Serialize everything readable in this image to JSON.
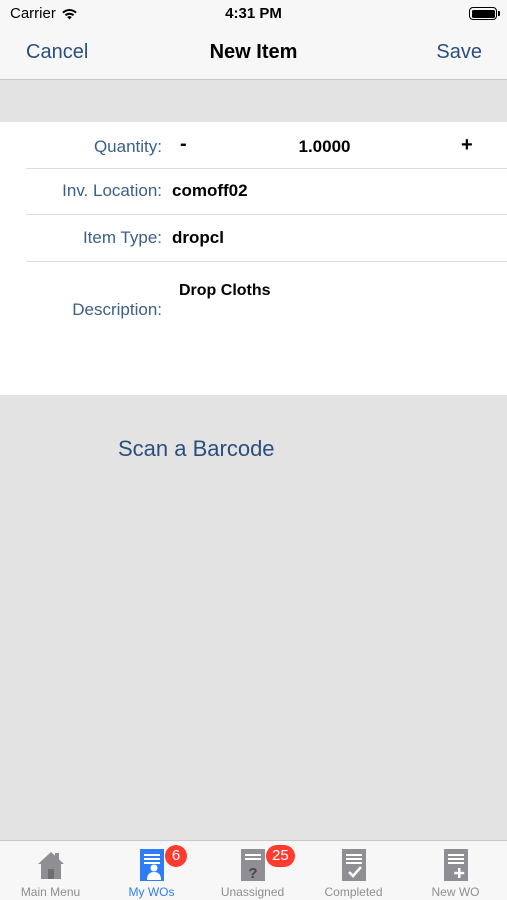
{
  "status_bar": {
    "carrier": "Carrier",
    "time": "4:31 PM"
  },
  "nav": {
    "cancel_label": "Cancel",
    "title": "New Item",
    "save_label": "Save"
  },
  "form": {
    "quantity": {
      "label": "Quantity:",
      "minus": "-",
      "value": "1.0000",
      "plus": "+"
    },
    "location": {
      "label": "Inv. Location:",
      "value": "comoff02"
    },
    "item_type": {
      "label": "Item Type:",
      "value": "dropcl"
    },
    "description": {
      "label": "Description:",
      "value": "Drop Cloths"
    }
  },
  "scan_label": "Scan a Barcode",
  "tabs": [
    {
      "label": "Main Menu",
      "icon": "house-icon",
      "active": false,
      "badge": ""
    },
    {
      "label": "My WOs",
      "icon": "my-workorders-icon",
      "active": true,
      "badge": "6"
    },
    {
      "label": "Unassigned",
      "icon": "unassigned-workorders-icon",
      "active": false,
      "badge": "25"
    },
    {
      "label": "Completed",
      "icon": "completed-workorders-icon",
      "active": false,
      "badge": ""
    },
    {
      "label": "New WO",
      "icon": "new-workorder-icon",
      "active": false,
      "badge": ""
    }
  ],
  "colors": {
    "accent": "#2b4f7d",
    "label": "#3a5f8a",
    "tab_active": "#2f7df6",
    "badge": "#ff3b30",
    "background": "#e3e3e3"
  }
}
